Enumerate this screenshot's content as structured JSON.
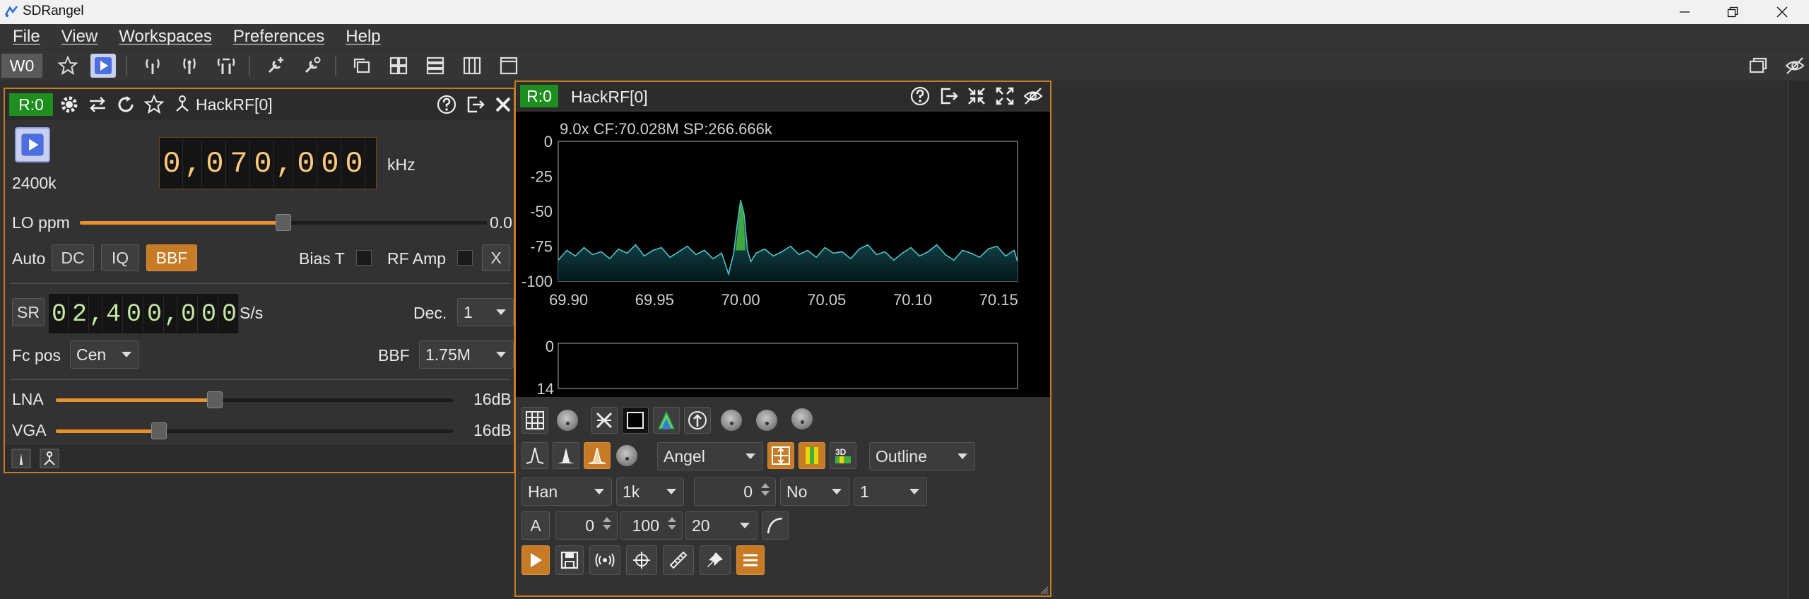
{
  "app": {
    "title": "SDRangel"
  },
  "menu": {
    "items": [
      "File",
      "View",
      "Workspaces",
      "Preferences",
      "Help"
    ]
  },
  "toolbar": {
    "workspace_label": "W0"
  },
  "device_panel": {
    "tag": "R:0",
    "title": "HackRF[0]",
    "sample_rate_label": "2400k",
    "frequency_digits": [
      "0",
      ",",
      "0",
      "7",
      "0",
      ",",
      "0",
      "0",
      "0"
    ],
    "frequency_unit": "kHz",
    "lo_ppm_label": "LO ppm",
    "lo_ppm_value": "0.0",
    "lo_ppm_level": 0.5,
    "auto_label": "Auto",
    "dc_label": "DC",
    "iq_label": "IQ",
    "bbf_button_label": "BBF",
    "bias_t_label": "Bias T",
    "rf_amp_label": "RF Amp",
    "x_label": "X",
    "sr_label": "SR",
    "sr_digits": [
      "0",
      "2",
      ",",
      "4",
      "0",
      "0",
      ",",
      "0",
      "0",
      "0"
    ],
    "sr_unit": "S/s",
    "dec_label": "Dec.",
    "dec_value": "1",
    "fc_pos_label": "Fc pos",
    "fc_pos_value": "Cen",
    "bbf_label": "BBF",
    "bbf_value": "1.75M",
    "lna_label": "LNA",
    "lna_value": "16dB",
    "lna_level": 0.4,
    "vga_label": "VGA",
    "vga_value": "16dB",
    "vga_level": 0.26
  },
  "spectrum_panel": {
    "tag": "R:0",
    "title": "HackRF[0]",
    "info": "9.0x CF:70.028M SP:266.666k",
    "y_ticks": [
      "0",
      "-25",
      "-50",
      "-75",
      "-100"
    ],
    "x_ticks": [
      "69.90",
      "69.95",
      "70.00",
      "70.05",
      "70.10",
      "70.15"
    ],
    "waterfall_ticks": [
      "0",
      "14"
    ],
    "palette_value": "Angel",
    "fill_mode_value": "Outline",
    "window_value": "Han",
    "fft_size_value": "1k",
    "overlap_value": "0",
    "averaging_mode_value": "No",
    "averaging_value": "1",
    "auto_button_label": "A",
    "ref_level_value": "0",
    "range_value": "100",
    "fps_value": "20"
  },
  "colors": {
    "accent": "#c67b24",
    "tag_green": "#1e8f1e",
    "digit_orange": "#ffc97b",
    "digit_green": "#c5e9a2",
    "spectrum_line": "#4fc3c7",
    "peak": "#3fa83f"
  },
  "chart_data": {
    "type": "line",
    "xlabel": "",
    "ylabel": "",
    "xlim": [
      69.894,
      70.161
    ],
    "ylim": [
      -100,
      0
    ],
    "x_ticks": [
      69.9,
      69.95,
      70.0,
      70.05,
      70.1,
      70.15
    ],
    "y_ticks": [
      0,
      -25,
      -50,
      -75,
      -100
    ],
    "grid": false,
    "series": [
      {
        "x": [
          69.894,
          69.899,
          69.904,
          69.909,
          69.914,
          69.919,
          69.924,
          69.929,
          69.934,
          69.939,
          69.944,
          69.949,
          69.954,
          69.959,
          69.964,
          69.969,
          69.974,
          69.979,
          69.984,
          69.989,
          69.993,
          69.996,
          69.998,
          70.0,
          70.002,
          70.004,
          70.006,
          70.009,
          70.014,
          70.019,
          70.024,
          70.029,
          70.034,
          70.039,
          70.044,
          70.049,
          70.054,
          70.059,
          70.064,
          70.069,
          70.074,
          70.079,
          70.084,
          70.089,
          70.094,
          70.099,
          70.104,
          70.109,
          70.114,
          70.119,
          70.124,
          70.129,
          70.134,
          70.139,
          70.144,
          70.149,
          70.154,
          70.159,
          70.161
        ],
        "y": [
          -85,
          -78,
          -82,
          -76,
          -81,
          -79,
          -84,
          -77,
          -80,
          -74,
          -82,
          -78,
          -76,
          -83,
          -79,
          -75,
          -81,
          -78,
          -84,
          -80,
          -95,
          -80,
          -60,
          -42,
          -52,
          -78,
          -86,
          -80,
          -77,
          -82,
          -79,
          -75,
          -81,
          -78,
          -83,
          -76,
          -80,
          -79,
          -84,
          -77,
          -74,
          -81,
          -79,
          -85,
          -80,
          -76,
          -82,
          -79,
          -74,
          -81,
          -85,
          -78,
          -80,
          -83,
          -77,
          -75,
          -82,
          -78,
          -86
        ]
      }
    ]
  }
}
